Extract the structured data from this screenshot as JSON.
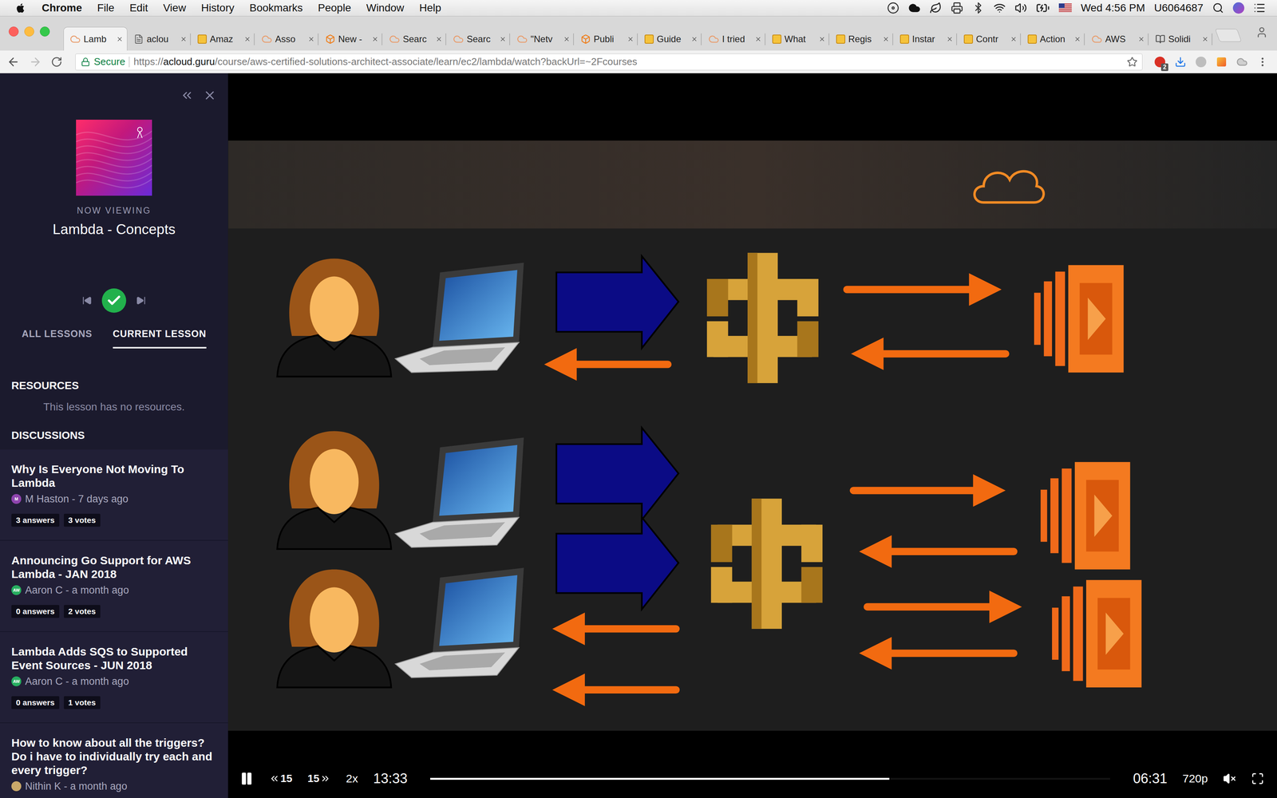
{
  "menubar": {
    "app": "Chrome",
    "menus": [
      "File",
      "Edit",
      "View",
      "History",
      "Bookmarks",
      "People",
      "Window",
      "Help"
    ],
    "clock": "Wed 4:56 PM",
    "user": "U6064687"
  },
  "tabs": [
    {
      "label": "Lamb",
      "kind": "cloud",
      "selected": true
    },
    {
      "label": "aclou",
      "kind": "doc",
      "selected": false
    },
    {
      "label": "Amaz",
      "kind": "aws",
      "selected": false
    },
    {
      "label": "Asso",
      "kind": "cloud",
      "selected": false
    },
    {
      "label": "New -",
      "kind": "box",
      "selected": false
    },
    {
      "label": "Searc",
      "kind": "cloud",
      "selected": false
    },
    {
      "label": "Searc",
      "kind": "cloud",
      "selected": false
    },
    {
      "label": "\"Netv",
      "kind": "cloud",
      "selected": false
    },
    {
      "label": "Publi",
      "kind": "box",
      "selected": false
    },
    {
      "label": "Guide",
      "kind": "aws",
      "selected": false
    },
    {
      "label": "I tried",
      "kind": "cloud",
      "selected": false
    },
    {
      "label": "What",
      "kind": "aws",
      "selected": false
    },
    {
      "label": "Regis",
      "kind": "aws",
      "selected": false
    },
    {
      "label": "Instar",
      "kind": "aws",
      "selected": false
    },
    {
      "label": "Contr",
      "kind": "aws",
      "selected": false
    },
    {
      "label": "Action",
      "kind": "aws",
      "selected": false
    },
    {
      "label": "AWS",
      "kind": "cloud",
      "selected": false
    },
    {
      "label": "Solidi",
      "kind": "book",
      "selected": false
    }
  ],
  "toolbar": {
    "secure": "Secure",
    "url_scheme": "https://",
    "url_host": "acloud.guru",
    "url_path": "/course/aws-certified-solutions-architect-associate/learn/ec2/lambda/watch?backUrl=~2Fcourses",
    "forward_disabled": true,
    "bookmarked": false,
    "extension_badge": "2"
  },
  "sidebar": {
    "now_viewing_label": "NOW VIEWING",
    "lesson_title": "Lambda - Concepts",
    "completed": true,
    "lesson_tabs": [
      {
        "label": "ALL LESSONS",
        "selected": false
      },
      {
        "label": "CURRENT LESSON",
        "selected": true
      }
    ],
    "resources_title": "RESOURCES",
    "resources_empty": "This lesson has no resources.",
    "discussions_title": "DISCUSSIONS",
    "discussions": [
      {
        "title": "Why Is Everyone Not Moving To Lambda",
        "byline": "M Haston - 7 days ago",
        "initials": "M",
        "color": "#8e44ad",
        "answers": "3 answers",
        "votes": "3 votes"
      },
      {
        "title": "Announcing Go Support for AWS Lambda - JAN 2018",
        "byline": "Aaron C - a month ago",
        "initials": "AW",
        "color": "#27ae60",
        "answers": "0 answers",
        "votes": "2 votes"
      },
      {
        "title": "Lambda Adds SQS to Supported Event Sources - JUN 2018",
        "byline": "Aaron C - a month ago",
        "initials": "AW",
        "color": "#27ae60",
        "answers": "0 answers",
        "votes": "1 votes"
      },
      {
        "title": "How to know about all the triggers? Do i have to individually try each and every trigger?",
        "byline": "Nithin K - a month ago",
        "color": "#c9a86a"
      }
    ]
  },
  "player": {
    "playing": true,
    "rewind": "15",
    "forward": "15",
    "speed": "2x",
    "elapsed": "13:33",
    "progress": 0.675,
    "remaining": "06:31",
    "quality": "720p",
    "muted": true
  }
}
